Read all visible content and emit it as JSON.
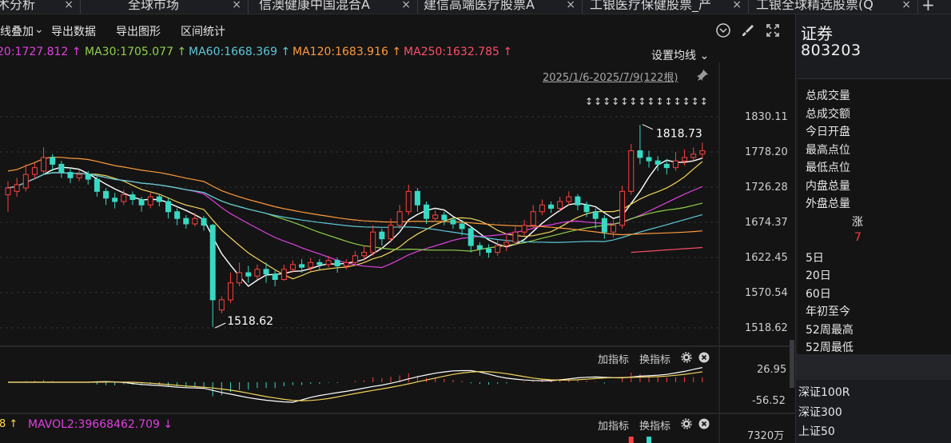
{
  "tabs": [
    {
      "label": "术分析",
      "close": "×",
      "left": -4,
      "width": 96
    },
    {
      "label": "全球市场",
      "close": "×",
      "left": 160,
      "width": 142
    },
    {
      "label": "信澳健康中国混合A",
      "close": "×",
      "left": 324,
      "width": 190
    },
    {
      "label": "建信高端医疗股票A",
      "close": "×",
      "left": 530,
      "width": 190
    },
    {
      "label": "工银医疗保健股票_产",
      "close": "×",
      "left": 738,
      "width": 190
    },
    {
      "label": "工银全球精选股票(Q",
      "close": "×",
      "left": 946,
      "width": 194
    }
  ],
  "add_tab": "+",
  "toolbar": {
    "overlay": "线叠加",
    "export_data": "导出数据",
    "export_chart": "导出图形",
    "interval_stats": "区间统计"
  },
  "ma": {
    "ma20": "20:1727.812 ↑",
    "ma30": "MA30:1705.077 ↑",
    "ma60": "MA60:1668.369 ↑",
    "ma120": "MA120:1683.916 ↑",
    "ma250": "MA250:1632.785 ↑",
    "settings": "设置均线",
    "colors": {
      "ma20": "#e040e0",
      "ma30": "#8fd04a",
      "ma60": "#5cc8d8",
      "ma120": "#ff9a3c",
      "ma250": "#ff4d6a"
    }
  },
  "date_range": "2025/1/6-2025/7/9(122根)",
  "y_axis": [
    "1830.11",
    "1778.20",
    "1726.28",
    "1674.37",
    "1622.45",
    "1570.54",
    "1518.62"
  ],
  "annotations": {
    "high": "1818.73",
    "low": "1518.62",
    "arrows": "↕↕↕↕↕↕↕↕↕↕↕↕↕↕"
  },
  "macd": {
    "add_indicator": "加指标",
    "switch_indicator": "换指标",
    "top": "26.95",
    "bottom": "-56.52"
  },
  "volume": {
    "label_left": "8",
    "mavol2": "MAVOL2:39668462.709",
    "add_indicator": "加指标",
    "switch_indicator": "换指标",
    "top": "7320万"
  },
  "panel": {
    "title": "证券",
    "code": "803203",
    "stats": [
      "总成交量",
      "总成交额",
      "今日开盘",
      "最高点位",
      "最低点位",
      "内盘总量",
      "外盘总量"
    ],
    "change_label": "涨",
    "change_value": "7",
    "periods": [
      "5日",
      "20日",
      "60日",
      "年初至今",
      "52周最高",
      "52周最低"
    ],
    "indices": [
      "深证100R",
      "深证300",
      "上证50"
    ]
  },
  "chart_data": {
    "type": "candlestick",
    "ylim": [
      1500,
      1850
    ],
    "candles": [
      [
        1715,
        1725,
        1690,
        1735
      ],
      [
        1720,
        1730,
        1712,
        1740
      ],
      [
        1725,
        1745,
        1720,
        1760
      ],
      [
        1745,
        1755,
        1738,
        1762
      ],
      [
        1750,
        1770,
        1745,
        1785
      ],
      [
        1770,
        1760,
        1750,
        1775
      ],
      [
        1760,
        1748,
        1740,
        1765
      ],
      [
        1748,
        1740,
        1732,
        1755
      ],
      [
        1740,
        1745,
        1735,
        1752
      ],
      [
        1745,
        1738,
        1730,
        1750
      ],
      [
        1738,
        1720,
        1712,
        1742
      ],
      [
        1720,
        1710,
        1700,
        1725
      ],
      [
        1710,
        1705,
        1695,
        1718
      ],
      [
        1705,
        1715,
        1700,
        1722
      ],
      [
        1715,
        1708,
        1700,
        1720
      ],
      [
        1708,
        1700,
        1690,
        1712
      ],
      [
        1700,
        1712,
        1695,
        1718
      ],
      [
        1712,
        1705,
        1698,
        1716
      ],
      [
        1705,
        1690,
        1680,
        1710
      ],
      [
        1690,
        1680,
        1670,
        1695
      ],
      [
        1680,
        1672,
        1665,
        1685
      ],
      [
        1672,
        1680,
        1668,
        1688
      ],
      [
        1680,
        1670,
        1662,
        1684
      ],
      [
        1670,
        1560,
        1520,
        1672
      ],
      [
        1545,
        1560,
        1540,
        1565
      ],
      [
        1560,
        1585,
        1555,
        1600
      ],
      [
        1585,
        1600,
        1580,
        1615
      ],
      [
        1600,
        1595,
        1585,
        1610
      ],
      [
        1595,
        1605,
        1590,
        1612
      ],
      [
        1605,
        1598,
        1585,
        1615
      ],
      [
        1598,
        1590,
        1580,
        1605
      ],
      [
        1590,
        1605,
        1588,
        1612
      ],
      [
        1605,
        1612,
        1600,
        1618
      ],
      [
        1612,
        1608,
        1600,
        1620
      ],
      [
        1608,
        1615,
        1602,
        1622
      ],
      [
        1615,
        1612,
        1605,
        1620
      ],
      [
        1612,
        1618,
        1608,
        1625
      ],
      [
        1618,
        1610,
        1600,
        1622
      ],
      [
        1610,
        1615,
        1605,
        1620
      ],
      [
        1615,
        1625,
        1610,
        1632
      ],
      [
        1625,
        1630,
        1618,
        1640
      ],
      [
        1630,
        1660,
        1625,
        1670
      ],
      [
        1660,
        1650,
        1640,
        1665
      ],
      [
        1650,
        1670,
        1645,
        1680
      ],
      [
        1670,
        1690,
        1665,
        1700
      ],
      [
        1690,
        1720,
        1685,
        1730
      ],
      [
        1720,
        1700,
        1690,
        1725
      ],
      [
        1700,
        1680,
        1672,
        1705
      ],
      [
        1680,
        1685,
        1675,
        1692
      ],
      [
        1685,
        1678,
        1670,
        1690
      ],
      [
        1678,
        1672,
        1665,
        1682
      ],
      [
        1672,
        1665,
        1655,
        1678
      ],
      [
        1665,
        1640,
        1630,
        1668
      ],
      [
        1640,
        1635,
        1625,
        1645
      ],
      [
        1635,
        1630,
        1622,
        1642
      ],
      [
        1630,
        1640,
        1625,
        1648
      ],
      [
        1640,
        1645,
        1632,
        1655
      ],
      [
        1645,
        1660,
        1640,
        1668
      ],
      [
        1660,
        1670,
        1655,
        1678
      ],
      [
        1670,
        1690,
        1665,
        1700
      ],
      [
        1690,
        1700,
        1685,
        1708
      ],
      [
        1700,
        1695,
        1688,
        1705
      ],
      [
        1695,
        1705,
        1690,
        1712
      ],
      [
        1705,
        1712,
        1700,
        1720
      ],
      [
        1712,
        1700,
        1692,
        1716
      ],
      [
        1700,
        1690,
        1682,
        1705
      ],
      [
        1690,
        1680,
        1665,
        1695
      ],
      [
        1680,
        1660,
        1650,
        1685
      ],
      [
        1660,
        1670,
        1652,
        1678
      ],
      [
        1670,
        1720,
        1665,
        1728
      ],
      [
        1720,
        1780,
        1715,
        1790
      ],
      [
        1780,
        1770,
        1760,
        1818
      ],
      [
        1770,
        1765,
        1755,
        1780
      ],
      [
        1765,
        1760,
        1750,
        1772
      ],
      [
        1760,
        1755,
        1745,
        1768
      ],
      [
        1755,
        1765,
        1750,
        1778
      ],
      [
        1765,
        1770,
        1758,
        1782
      ],
      [
        1770,
        1775,
        1765,
        1785
      ],
      [
        1775,
        1780,
        1768,
        1792
      ]
    ]
  }
}
